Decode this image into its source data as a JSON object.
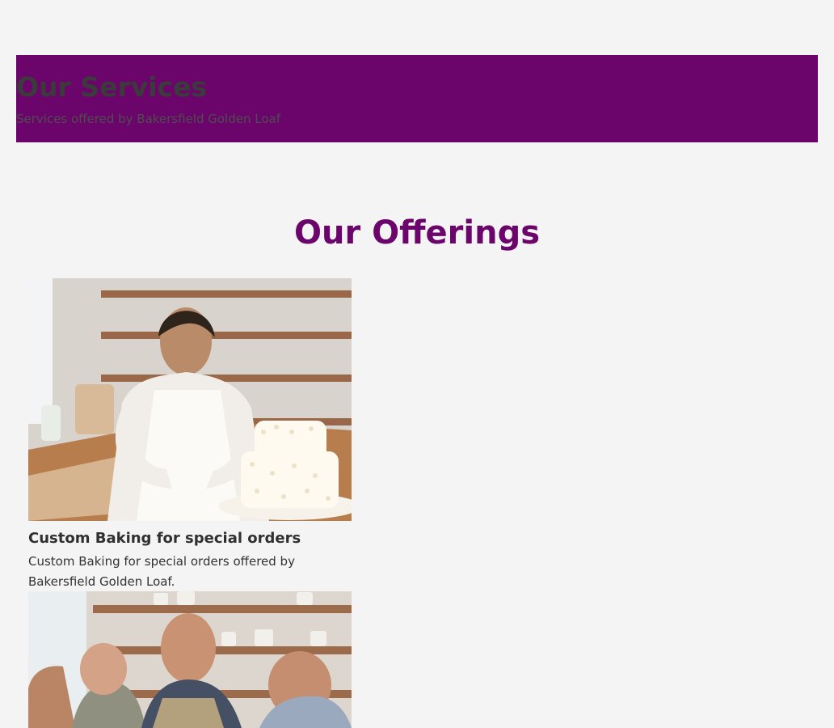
{
  "hero": {
    "title": "Our Services",
    "subtitle": "Services offered by Bakersfield Golden Loaf"
  },
  "section": {
    "title": "Our Offerings"
  },
  "services": [
    {
      "title": "Custom Baking for special orders",
      "description": "Custom Baking for special orders offered by Bakersfield Golden Loaf.",
      "image_icon": "bakery-cake-photo-icon"
    },
    {
      "image_icon": "baking-class-photo-icon"
    }
  ],
  "colors": {
    "page_background": "#f4f4f4",
    "brand_purple": "#6b046b",
    "heading_text": "#3b3b3b",
    "body_text": "#333333"
  }
}
